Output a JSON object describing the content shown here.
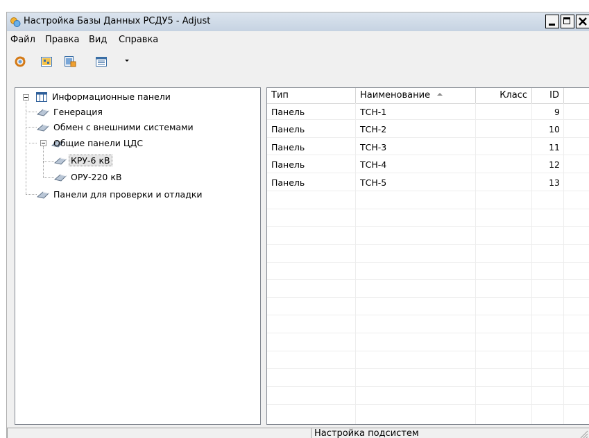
{
  "window": {
    "title": "Настройка Базы Данных РСДУ5 - Adjust"
  },
  "menu": {
    "items": [
      "Файл",
      "Правка",
      "Вид",
      "Справка"
    ]
  },
  "toolbar": {
    "buttons": [
      "refresh-icon",
      "panel-view-icon",
      "panel-settings-icon",
      "list-view-icon"
    ]
  },
  "tree": {
    "root": "Информационные панели",
    "children": [
      {
        "label": "Генерация"
      },
      {
        "label": "Обмен с внешними системами"
      },
      {
        "label": "Общие панели ЦДС",
        "children": [
          {
            "label": "КРУ-6 кВ",
            "selected": true
          },
          {
            "label": "ОРУ-220 кВ"
          }
        ]
      },
      {
        "label": "Панели для проверки и отладки"
      }
    ]
  },
  "list": {
    "columns": [
      "Тип",
      "Наименование",
      "Класс",
      "ID"
    ],
    "sort_column": "Наименование",
    "rows": [
      {
        "type": "Панель",
        "name": "ТСН-1",
        "class": "",
        "id": "9"
      },
      {
        "type": "Панель",
        "name": "ТСН-2",
        "class": "",
        "id": "10"
      },
      {
        "type": "Панель",
        "name": "ТСН-3",
        "class": "",
        "id": "11"
      },
      {
        "type": "Панель",
        "name": "ТСН-4",
        "class": "",
        "id": "12"
      },
      {
        "type": "Панель",
        "name": "ТСН-5",
        "class": "",
        "id": "13"
      }
    ]
  },
  "statusbar": {
    "left": "",
    "center": "Настройка подсистем"
  },
  "colors": {
    "titlebar": "#c6d3e2",
    "background": "#f0f0f0",
    "selection": "#e5e5e5"
  }
}
